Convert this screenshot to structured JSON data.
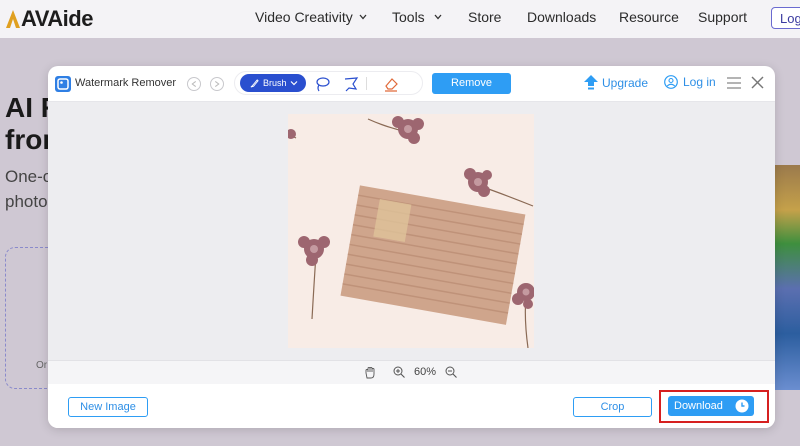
{
  "site": {
    "logo_text": "AVAide",
    "nav": [
      {
        "label": "Video Creativity",
        "dropdown": true
      },
      {
        "label": "Tools",
        "dropdown": true
      },
      {
        "label": "Store",
        "dropdown": false
      },
      {
        "label": "Downloads",
        "dropdown": false
      },
      {
        "label": "Resource",
        "dropdown": false
      },
      {
        "label": "Support",
        "dropdown": false
      }
    ],
    "login_label": "Log",
    "hero_line1": "AI R",
    "hero_line2": "fron",
    "hero_sub1": "One-c",
    "hero_sub2": "photo",
    "upload_or": "Or"
  },
  "modal": {
    "title": "Watermark Remover",
    "brush_label": "Brush",
    "remove_label": "Remove",
    "upgrade_label": "Upgrade",
    "login_label": "Log in",
    "zoom_value": "60%",
    "new_image_label": "New Image",
    "crop_label": "Crop",
    "download_label": "Download"
  },
  "colors": {
    "accent": "#2e9df4",
    "brush_active": "#2a4fcf",
    "highlight": "#d62020"
  },
  "icons": [
    "app-icon",
    "undo-icon",
    "redo-icon",
    "brush-icon",
    "lasso-icon",
    "polygon-lasso-icon",
    "eraser-icon",
    "upgrade-icon",
    "user-icon",
    "menu-icon",
    "close-icon",
    "hand-icon",
    "zoom-in-icon",
    "zoom-out-icon",
    "clock-icon"
  ]
}
